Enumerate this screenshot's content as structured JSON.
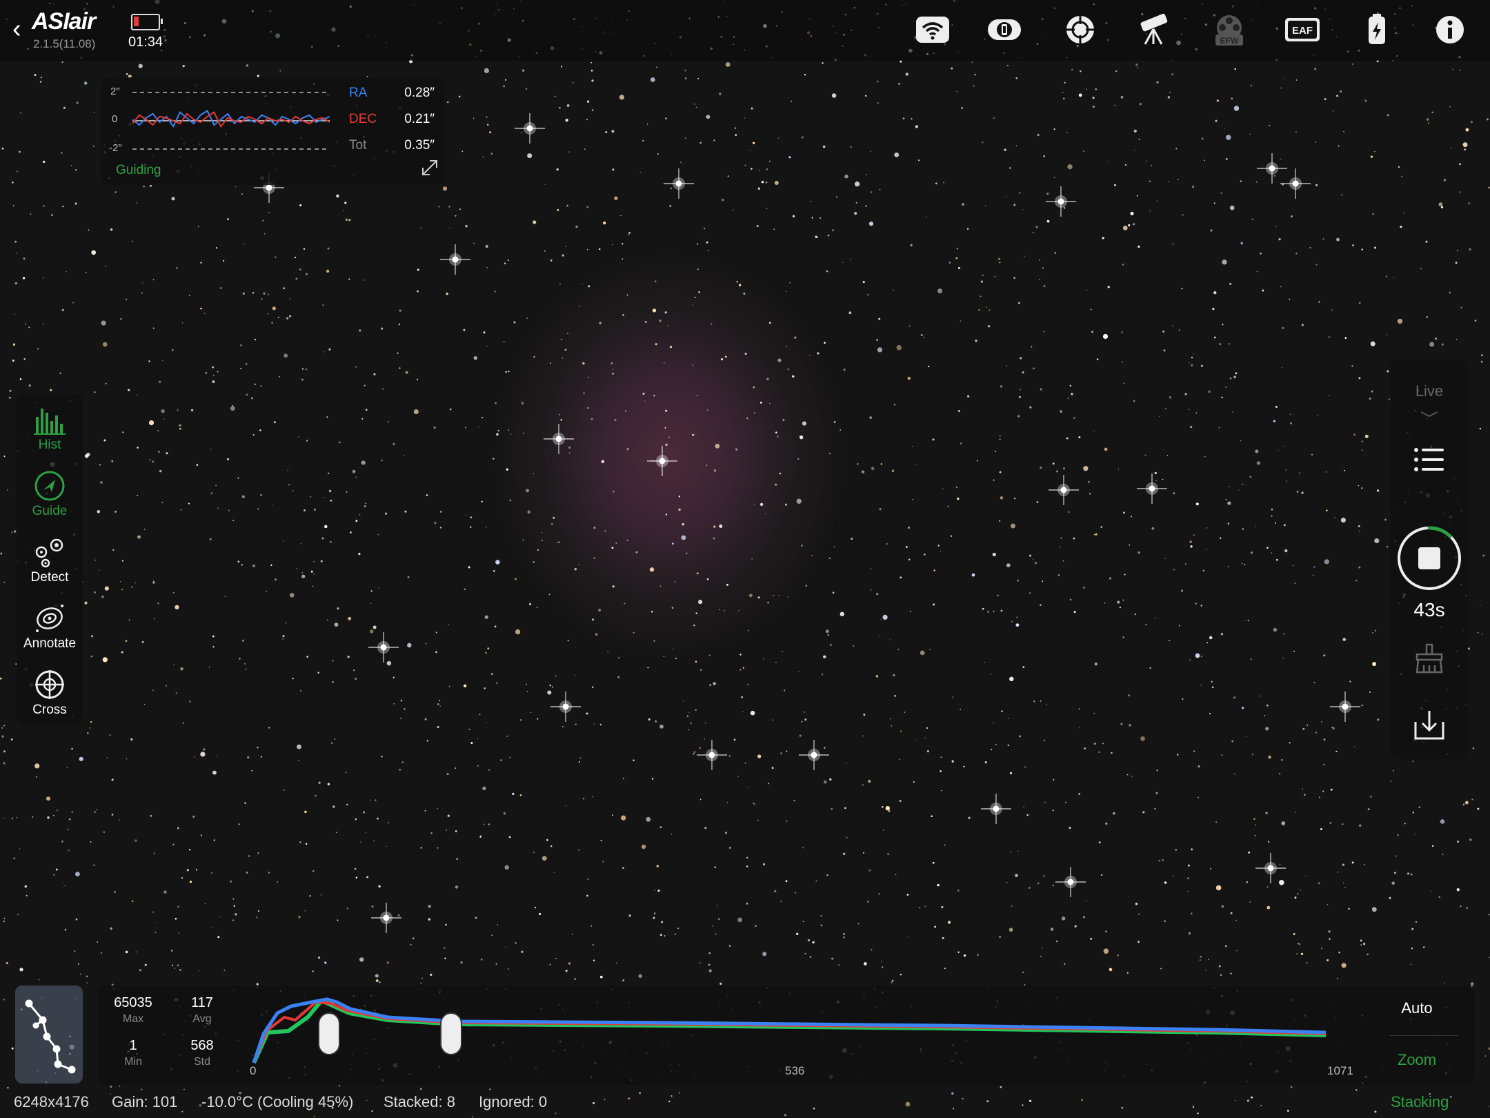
{
  "app": {
    "logo": "ASIair",
    "version": "2.1.5(11.08)",
    "clock": "01:34",
    "battery_level": 0.2,
    "battery_color": "#e53935"
  },
  "top_icons": [
    "wifi-icon",
    "camera-icon",
    "guide-target-icon",
    "telescope-icon",
    "efw-filter-wheel-icon",
    "eaf-focuser-icon",
    "usb-power-icon",
    "info-icon"
  ],
  "top_icon_labels": {
    "efw": "EFW",
    "eaf": "EAF"
  },
  "guiding": {
    "ticks": [
      "2″",
      "0",
      "-2″"
    ],
    "ra_label": "RA",
    "ra_value": "0.28″",
    "ra_color": "#3b82f6",
    "dec_label": "DEC",
    "dec_value": "0.21″",
    "dec_color": "#e53935",
    "tot_label": "Tot",
    "tot_value": "0.35″",
    "status": "Guiding",
    "ra_series": [
      0.1,
      -0.3,
      0.2,
      0.5,
      -0.1,
      0.3,
      -0.4,
      0.6,
      0.2,
      -0.2,
      0.4,
      0.7,
      -0.3,
      0.1,
      0.5,
      -0.2,
      0.3,
      0.1,
      -0.1,
      0.4,
      0.2,
      -0.3,
      0.3,
      0.1,
      -0.2,
      0.2,
      0.4,
      -0.1,
      0.1,
      0.3
    ],
    "dec_series": [
      -0.2,
      0.4,
      0.1,
      -0.3,
      0.3,
      0.2,
      0.0,
      -0.2,
      0.5,
      0.1,
      -0.1,
      0.3,
      0.6,
      -0.4,
      0.2,
      0.0,
      -0.1,
      0.3,
      0.1,
      -0.2,
      0.2,
      0.0,
      0.1,
      -0.1,
      0.3,
      0.0,
      -0.2,
      0.1,
      0.2,
      -0.1
    ]
  },
  "left_tools": [
    {
      "label": "Hist",
      "icon": "histogram-icon",
      "active": true
    },
    {
      "label": "Guide",
      "icon": "guide-arrow-icon",
      "active": true
    },
    {
      "label": "Detect",
      "icon": "detect-stars-icon",
      "active": false
    },
    {
      "label": "Annotate",
      "icon": "annotate-galaxy-icon",
      "active": false
    },
    {
      "label": "Cross",
      "icon": "crosshair-icon",
      "active": false
    }
  ],
  "right_tools": {
    "live_label": "Live",
    "exposure_time": "43s",
    "progress": 0.12
  },
  "histogram": {
    "max_value": "65035",
    "max_label": "Max",
    "avg_value": "117",
    "avg_label": "Avg",
    "min_value": "1",
    "min_label": "Min",
    "std_value": "568",
    "std_label": "Std",
    "axis_start": "0",
    "axis_mid": "536",
    "axis_end": "1071",
    "low_handle": 115,
    "high_handle": 292,
    "auto_label": "Auto",
    "zoom_label": "Zoom"
  },
  "status": {
    "resolution": "6248x4176",
    "gain": "Gain: 101",
    "temperature": "-10.0°C (Cooling 45%)",
    "stacked": "Stacked: 8",
    "ignored": "Ignored: 0",
    "mode": "Stacking"
  }
}
